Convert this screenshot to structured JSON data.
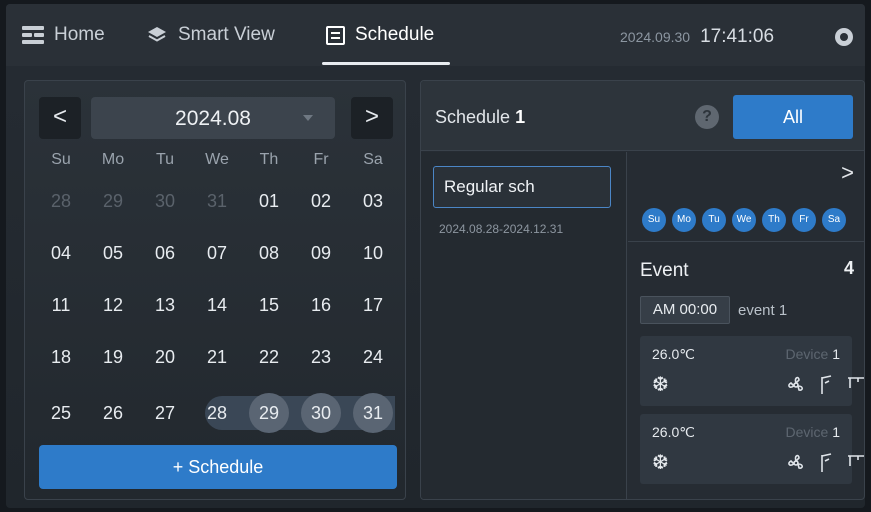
{
  "nav": {
    "home_label": "Home",
    "smart_view_label": "Smart View",
    "schedule_label": "Schedule",
    "date": "2024.09.30",
    "time": "17:41:06"
  },
  "calendar": {
    "prev": "<",
    "next": ">",
    "month": "2024.08",
    "weekdays": [
      "Su",
      "Mo",
      "Tu",
      "We",
      "Th",
      "Fr",
      "Sa"
    ],
    "weeks": [
      [
        "28",
        "29",
        "30",
        "31",
        "01",
        "02",
        "03"
      ],
      [
        "04",
        "05",
        "06",
        "07",
        "08",
        "09",
        "10"
      ],
      [
        "11",
        "12",
        "13",
        "14",
        "15",
        "16",
        "17"
      ],
      [
        "18",
        "19",
        "20",
        "21",
        "22",
        "23",
        "24"
      ],
      [
        "25",
        "26",
        "27",
        "28",
        "29",
        "30",
        "31"
      ]
    ],
    "add_button": "+ Schedule"
  },
  "schedule": {
    "title_prefix": "Schedule",
    "title_number": "1",
    "help": "?",
    "all_button": "All",
    "item_name": "Regular sch",
    "item_range": "2024.08.28-2024.12.31",
    "next": ">",
    "days": [
      "Su",
      "Mo",
      "Tu",
      "We",
      "Th",
      "Fr",
      "Sa"
    ],
    "event_label": "Event",
    "event_count": "4",
    "event_time": "AM 00:00",
    "event_name": "event 1",
    "devices": [
      {
        "temp": "26.0℃",
        "label": "Device",
        "num": "1"
      },
      {
        "temp": "26.0℃",
        "label": "Device",
        "num": "1"
      }
    ]
  },
  "colors": {
    "accent": "#2e7bc9",
    "highlight": "#5a6573"
  }
}
